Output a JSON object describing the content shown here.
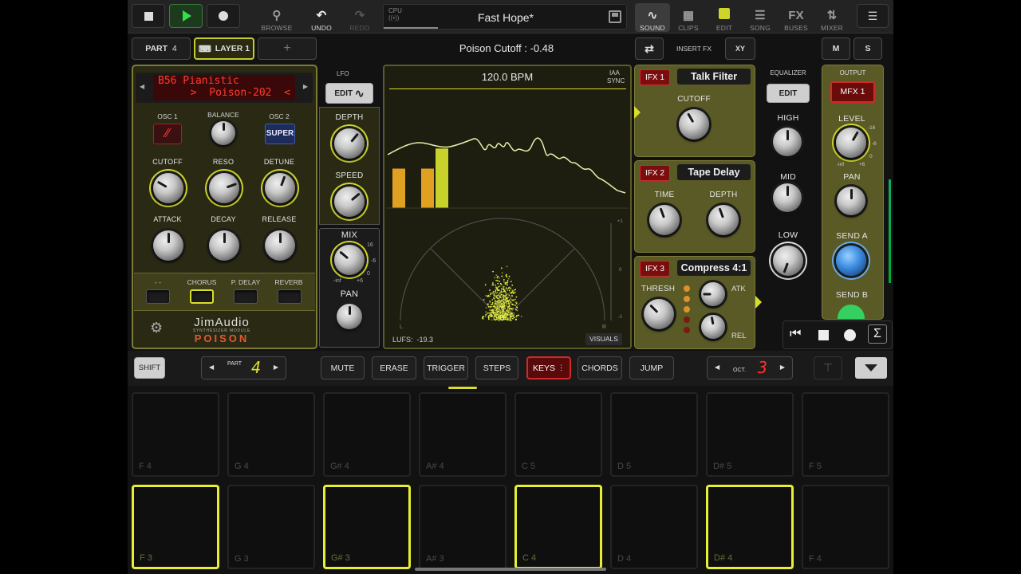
{
  "transport": {
    "stop": "stop",
    "play": "play",
    "record": "record"
  },
  "nav": {
    "browse": "BROWSE",
    "undo": "UNDO",
    "redo": "REDO",
    "cpu": "CPU",
    "song_title": "Fast Hope*",
    "sound": "SOUND",
    "clips": "CLIPS",
    "edit": "EDIT",
    "song": "SONG",
    "buses": "BUSES",
    "mixer": "MIXER",
    "fx": "FX"
  },
  "row2": {
    "part_label": "PART",
    "part_num": "4",
    "layer": "LAYER 1",
    "add": "+",
    "param_readout": "Poison Cutoff :  -0.48",
    "insert_fx": "INSERT FX",
    "xy": "XY",
    "m": "M",
    "s": "S"
  },
  "synth": {
    "preset_line1": "B56 Pianistic",
    "preset_line2": ">  Poison-202  <",
    "osc1": "OSC 1",
    "balance": "BALANCE",
    "osc2": "OSC 2",
    "super": "SUPER",
    "cutoff": "CUTOFF",
    "reso": "RESO",
    "detune": "DETUNE",
    "attack": "ATTACK",
    "decay": "DECAY",
    "release": "RELEASE",
    "fx_none": "- -",
    "chorus": "CHORUS",
    "pdelay": "P. DELAY",
    "reverb": "REVERB",
    "brand": "JimAudio",
    "brand_sub": "SYNTHESIZER MODULE",
    "brand_name": "POISON"
  },
  "lfo": {
    "title": "LFO",
    "edit": "EDIT",
    "depth": "DEPTH",
    "speed": "SPEED",
    "mix": "MIX",
    "pan": "PAN",
    "s16": "16",
    "sm6": "-6",
    "s0": "0",
    "sinf": "-inf",
    "s6": "+6"
  },
  "visual": {
    "bpm": "120.0 BPM",
    "iaa": "IAA",
    "sync": "SYNC",
    "lufs": "LUFS:  -19.3",
    "visuals": "VISUALS",
    "l": "L",
    "r": "R",
    "p1": "+1",
    "z": "0",
    "m1": "-1"
  },
  "ifx": [
    {
      "tag": "IFX 1",
      "name": "Talk Filter",
      "p1": "CUTOFF"
    },
    {
      "tag": "IFX 2",
      "name": "Tape Delay",
      "p1": "TIME",
      "p2": "DEPTH"
    },
    {
      "tag": "IFX 3",
      "name": "Compress 4:1",
      "p1": "THRESH",
      "p2": "ATK",
      "p3": "REL"
    }
  ],
  "eq": {
    "title": "EQUALIZER",
    "edit": "EDIT",
    "high": "HIGH",
    "mid": "MID",
    "low": "LOW"
  },
  "output": {
    "title": "OUTPUT",
    "mfx": "MFX 1",
    "level": "LEVEL",
    "pan": "PAN",
    "senda": "SEND A",
    "sendb": "SEND B",
    "t16": "-16",
    "t6": "-6",
    "t0": "0",
    "tinf": "-inf",
    "tp6": "+6"
  },
  "bar": {
    "shift": "SHIFT",
    "part": "PART",
    "part_val": "4",
    "mute": "MUTE",
    "erase": "ERASE",
    "trigger": "TRIGGER",
    "steps": "STEPS",
    "keys": "KEYS",
    "chords": "CHORDS",
    "jump": "JUMP",
    "oct": "OCT.",
    "oct_val": "3"
  },
  "pads_top": [
    "F 4",
    "G 4",
    "G# 4",
    "A# 4",
    "C 5",
    "D 5",
    "D# 5",
    "F 5"
  ],
  "pads_bottom": [
    "F 3",
    "G 3",
    "G# 3",
    "A# 3",
    "C 4",
    "D 4",
    "D# 4",
    "F 4"
  ],
  "spectrum_bars": [
    0.55,
    0.55,
    0.83
  ],
  "colors": {
    "accent": "#d8df2a",
    "olive": "#5a5a26",
    "red": "#d02a2a"
  }
}
